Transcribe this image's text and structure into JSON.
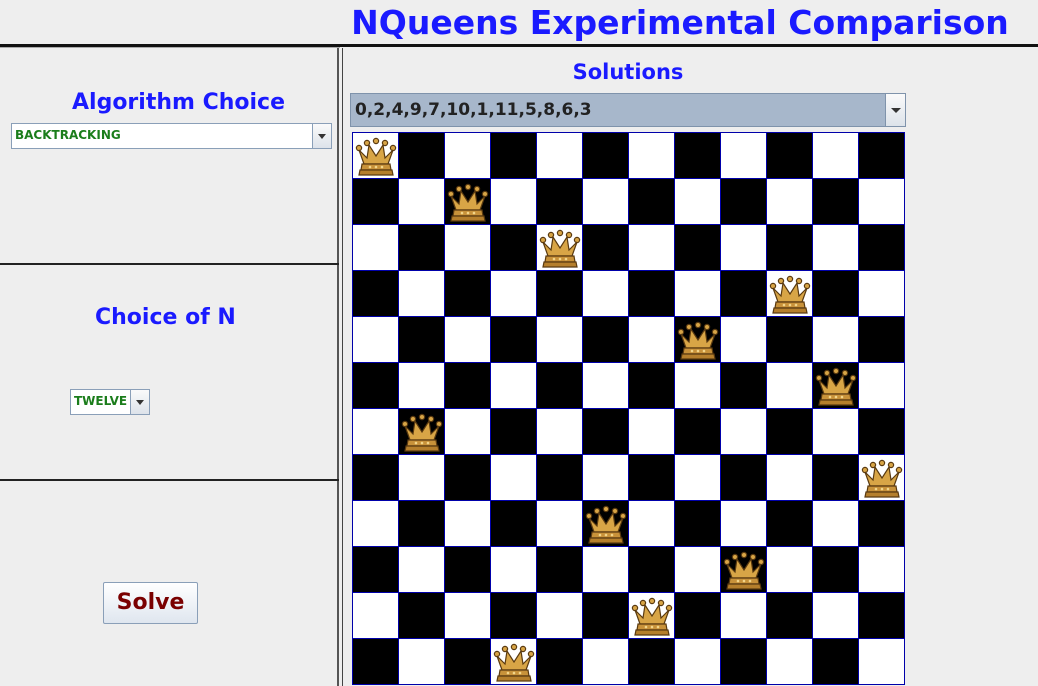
{
  "header": {
    "title": "NQueens Experimental Comparison"
  },
  "algorithm": {
    "label": "Algorithm Choice",
    "selected": "BACKTRACKING"
  },
  "n_choice": {
    "label": "Choice of N",
    "selected": "TWELVE"
  },
  "solve": {
    "label": "Solve"
  },
  "solutions": {
    "label": "Solutions",
    "selected": "0,2,4,9,7,10,1,11,5,8,6,3"
  },
  "board": {
    "size": 12,
    "queen_columns": [
      0,
      2,
      4,
      9,
      7,
      10,
      1,
      11,
      5,
      8,
      6,
      3
    ],
    "light_color": "#ffffff",
    "dark_color": "#000000",
    "grid_color": "#0000aa",
    "piece_icon": "queen-icon"
  },
  "colors": {
    "title": "#1a1aff",
    "combo_value": "#1b7d1b",
    "solve_text": "#7a0000"
  }
}
